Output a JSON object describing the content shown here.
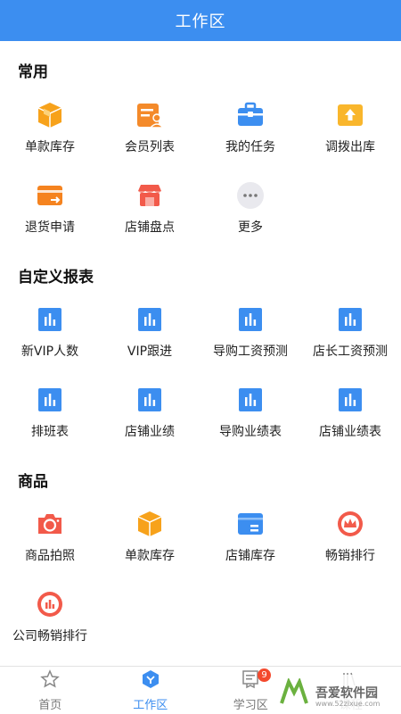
{
  "header": {
    "title": "工作区"
  },
  "sections": {
    "common": {
      "title": "常用",
      "items": [
        "单款库存",
        "会员列表",
        "我的任务",
        "调拨出库",
        "退货申请",
        "店铺盘点",
        "更多"
      ]
    },
    "reports": {
      "title": "自定义报表",
      "items": [
        "新VIP人数",
        "VIP跟进",
        "导购工资预测",
        "店长工资预测",
        "排班表",
        "店铺业绩",
        "导购业绩表",
        "店铺业绩表"
      ]
    },
    "goods": {
      "title": "商品",
      "items": [
        "商品拍照",
        "单款库存",
        "店铺库存",
        "畅销排行",
        "公司畅销排行"
      ]
    }
  },
  "tabbar": {
    "tabs": [
      "首页",
      "工作区",
      "学习区",
      "课程"
    ],
    "badge": "9"
  },
  "watermark": {
    "text": "吾爱软件园",
    "sub": "www.52zixue.com"
  },
  "colors": {
    "primary": "#3c8ef0",
    "orange": "#f7a21b",
    "red": "#f25a4a"
  }
}
